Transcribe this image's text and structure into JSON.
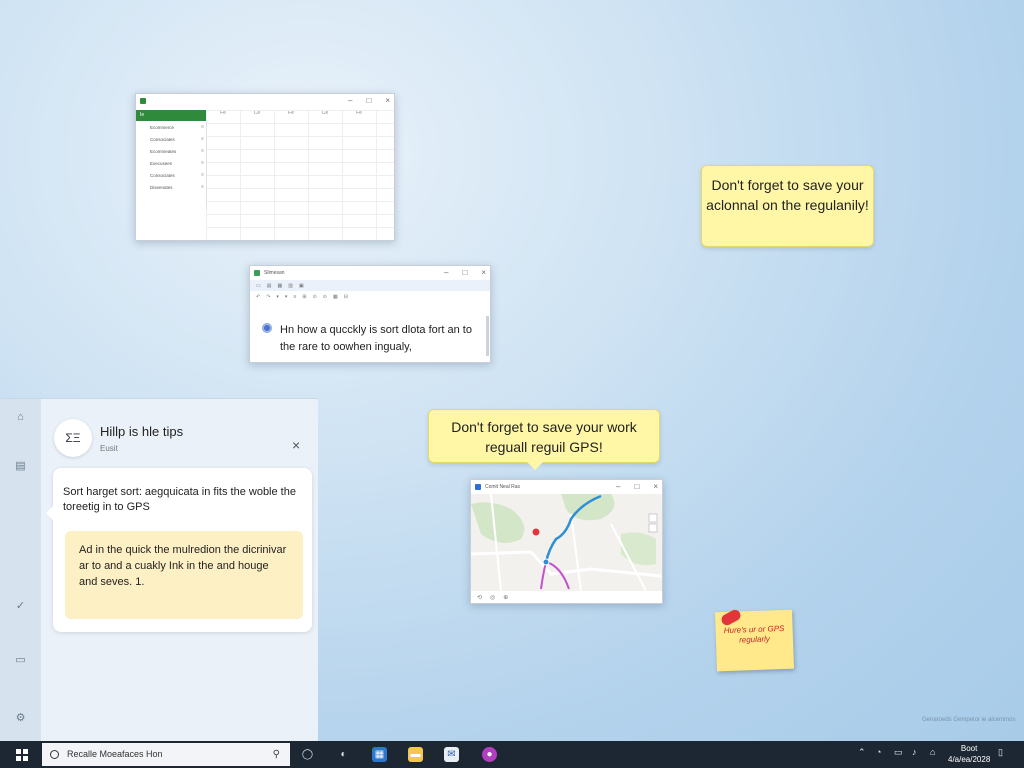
{
  "spreadsheet": {
    "rows": [
      "Ecommerce",
      "Consociates",
      "Ecommeates",
      "Execusees",
      "Consociates",
      "Diseenates"
    ],
    "green_label": "Ie",
    "columns": [
      "Fe",
      "Ce",
      "Fe",
      "Ce",
      "Fe"
    ]
  },
  "document": {
    "title": "Slimesan",
    "text": "Hn how a qucckly is sort dlota fort an to the rare to oowhen ingualy,"
  },
  "notes": {
    "top_right": "Don't forget to save your aclonnal on the regulanily!",
    "center": "Don't forget to save your work reguall reguil GPS!",
    "postit": "Hure's ur or GPS regularly"
  },
  "map_window": {
    "title": "Comit Neal Ras"
  },
  "help_panel": {
    "logo": "ΣΞ",
    "title": "Hillp is hle tips",
    "subtitle": "Eusit",
    "close": "×",
    "text": "Sort harget sort: aegquicata in fits the woble the toreetig in to GPS",
    "tip": "Ad in the quick the mulredion the dicrinivar ar to and a cuakly Ink in the and houge and seves. 1."
  },
  "taskbar": {
    "search_placeholder": "Recalle Moeafaces Hon",
    "clock_time": "Boot",
    "clock_date": "4/a/ea/2028"
  },
  "watermark": "Genaroeds Gempetor ie alcemmos",
  "colors": {
    "accent_green": "#2f8a3b",
    "note_yellow": "#fff7a6",
    "postit_text": "#c2262b",
    "taskbar": "#1d2733"
  }
}
